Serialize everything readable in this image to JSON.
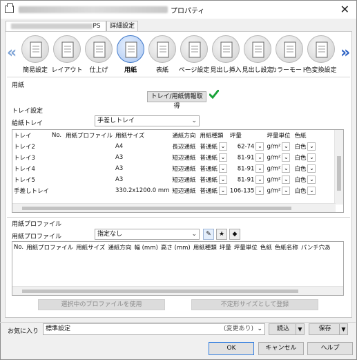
{
  "window": {
    "title": "プロパティ",
    "close_glyph": "✕"
  },
  "tabs": [
    {
      "label": "PS"
    },
    {
      "label": "詳細設定"
    }
  ],
  "functions": [
    {
      "label": "簡易設定",
      "icon": "quick-setup-icon"
    },
    {
      "label": "レイアウト",
      "icon": "layout-icon"
    },
    {
      "label": "仕上げ",
      "icon": "finishing-icon"
    },
    {
      "label": "用紙",
      "icon": "paper-icon",
      "selected": true
    },
    {
      "label": "表紙",
      "icon": "cover-icon"
    },
    {
      "label": "ページ設定",
      "icon": "page-setting-icon"
    },
    {
      "label": "見出し挿入",
      "icon": "tab-insert-icon"
    },
    {
      "label": "見出し設定",
      "icon": "tab-setting-icon"
    },
    {
      "label": "カラーモード",
      "icon": "color-mode-icon"
    },
    {
      "label": "色変換設定",
      "icon": "color-convert-icon"
    }
  ],
  "paper": {
    "group_label": "用紙",
    "get_tray_info_button": "トレイ/用紙情報取得",
    "tray_settings_label": "トレイ設定",
    "feed_tray_label": "給紙トレイ",
    "feed_tray_value": "手差しトレイ",
    "tray_table": {
      "columns": [
        "トレイ",
        "No.",
        "用紙プロファイル",
        "用紙サイズ",
        "通紙方向",
        "用紙種類",
        "坪量",
        "坪量単位",
        "色紙"
      ],
      "rows": [
        [
          "トレイ2",
          "",
          "",
          "A4",
          "長辺通紙",
          "普通紙",
          "62-74",
          "g/m²",
          "白色"
        ],
        [
          "トレイ3",
          "",
          "",
          "A3",
          "短辺通紙",
          "普通紙",
          "81-91",
          "g/m²",
          "白色"
        ],
        [
          "トレイ4",
          "",
          "",
          "A3",
          "短辺通紙",
          "普通紙",
          "81-91",
          "g/m²",
          "白色"
        ],
        [
          "トレイ5",
          "",
          "",
          "A3",
          "短辺通紙",
          "普通紙",
          "81-91",
          "g/m²",
          "白色"
        ],
        [
          "手差しトレイ",
          "",
          "",
          "330.2x1200.0 mm",
          "短辺通紙",
          "普通紙",
          "106-135",
          "g/m²",
          "白色"
        ]
      ]
    },
    "profile_group_label": "用紙プロファイル",
    "profile_label": "用紙プロファイル",
    "profile_value": "指定なし",
    "profile_table_columns": [
      "No.",
      "用紙プロファイル",
      "用紙サイズ",
      "通紙方向",
      "幅 (mm)",
      "高さ (mm)",
      "用紙種類",
      "坪量",
      "坪量単位",
      "色紙",
      "色紙名称",
      "パンチ穴あ"
    ],
    "use_profile_button": "選択中のプロファイルを使用",
    "register_custom_button": "不定形サイズとして登録"
  },
  "favorites": {
    "label": "お気に入り",
    "value": "標準設定",
    "changed": "(変更あり)",
    "load_button": "読込",
    "save_button": "保存"
  },
  "dialog": {
    "ok": "OK",
    "cancel": "キャンセル",
    "help": "ヘルプ"
  },
  "colors": {
    "accent": "#2f64c4",
    "check": "#1aa33a"
  }
}
